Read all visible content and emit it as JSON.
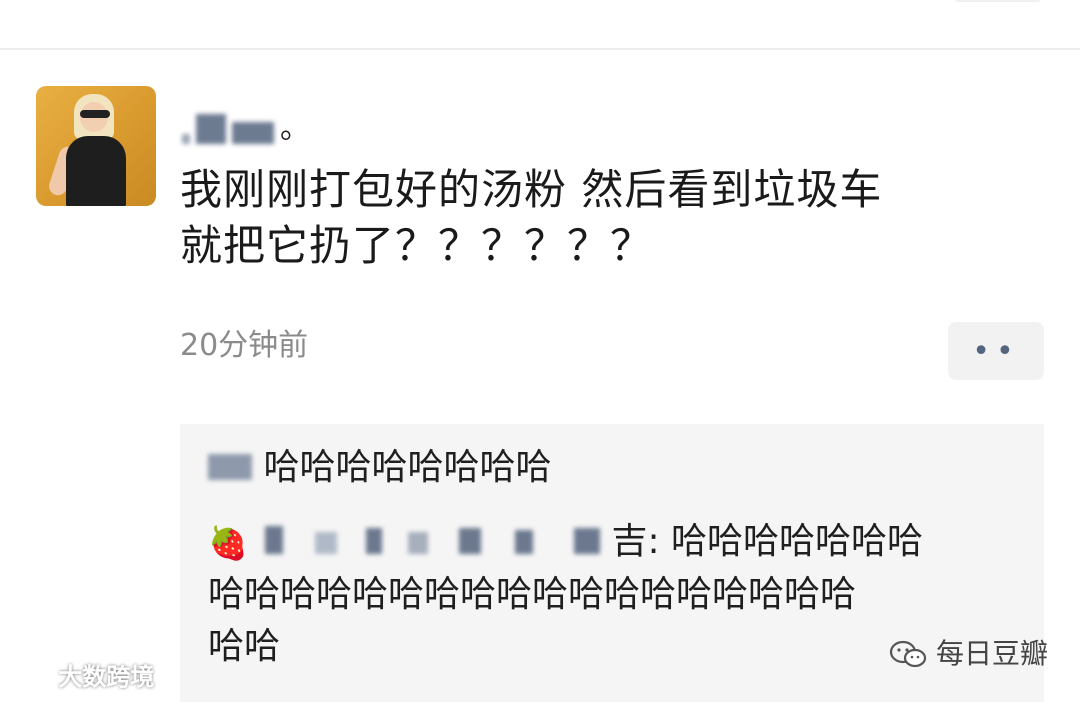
{
  "post": {
    "text_line_1": "我刚刚打包好的汤粉 然后看到垃圾车",
    "text_line_2": "就把它扔了？？？？？？",
    "timestamp": "20分钟前",
    "username_visible": "。"
  },
  "more_button": {
    "label": "••"
  },
  "comments": [
    {
      "text": "哈哈哈哈哈哈哈哈"
    },
    {
      "prefix_emoji": "🍓",
      "name_tail": "吉",
      "text_line_1": ": 哈哈哈哈哈哈哈",
      "text_line_2": "哈哈哈哈哈哈哈哈哈哈哈哈哈哈哈哈哈哈",
      "text_line_3": "哈哈"
    }
  ],
  "watermarks": {
    "left": "大数跨境",
    "right": "每日豆瓣"
  },
  "colors": {
    "background": "#ffffff",
    "comment_background": "#f5f5f5",
    "timestamp": "#8b8b8b",
    "text": "#1a1a1a"
  },
  "icons": [
    "wechat-icon",
    "strawberry-emoji",
    "weibo-icon"
  ]
}
